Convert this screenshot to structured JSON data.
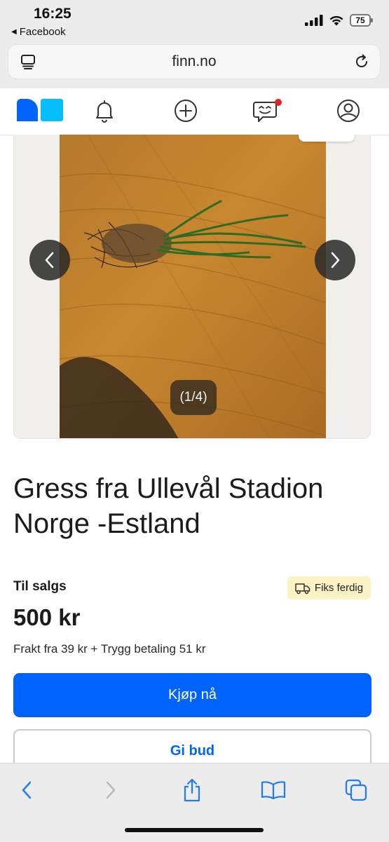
{
  "status": {
    "time": "16:25",
    "back_app": "Facebook",
    "battery": "75"
  },
  "browser": {
    "url": "finn.no"
  },
  "finn_nav": {
    "items": [
      "logo",
      "notifications",
      "new-ad",
      "messages",
      "profile"
    ],
    "brand_colors": {
      "dark": "#0063fb",
      "light": "#06befb"
    },
    "unread_dot_color": "#e5201e"
  },
  "listing": {
    "image_counter": "(1/4)",
    "title": "Gress fra Ullevål Stadion Norge -Estland",
    "sale_status": "Til salgs",
    "shipping_badge": "Fiks ferdig",
    "price": "500 kr",
    "shipping_info": "Frakt fra 39 kr + Trygg betaling 51 kr",
    "buy_label": "Kjøp nå",
    "bid_label": "Gi bud",
    "accent_color": "#0063fb"
  },
  "safari_toolbar": {
    "items": [
      "back",
      "forward",
      "share",
      "bookmarks",
      "tabs"
    ],
    "tint": "#1f7bf2"
  }
}
